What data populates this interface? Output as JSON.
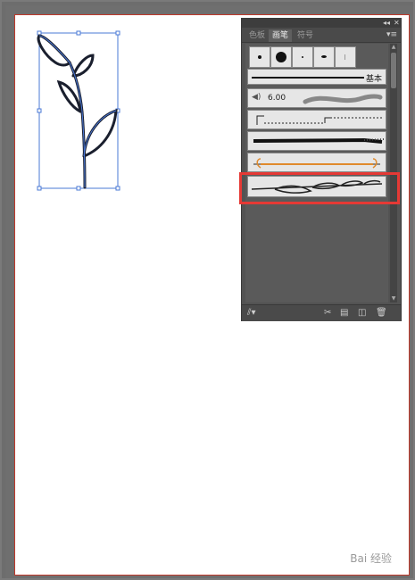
{
  "panel": {
    "tabs": [
      "色板",
      "画笔",
      "符号"
    ],
    "active_tab_index": 1,
    "menu_icon": "panel-menu-icon",
    "brush_rows": {
      "basic_label": "基本",
      "size_value": "6.00"
    },
    "bottom_icons": [
      "brush-library-icon",
      "remove-stroke-icon",
      "options-icon",
      "new-brush-icon",
      "delete-icon"
    ]
  },
  "watermark": "Bai 经验"
}
